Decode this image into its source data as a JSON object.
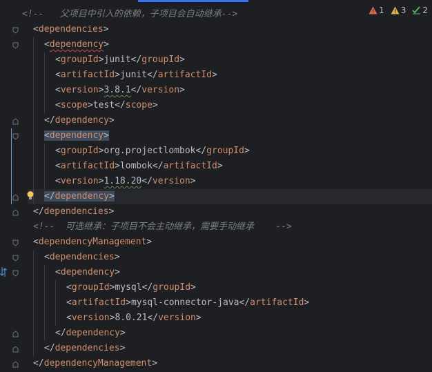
{
  "editor": {
    "inspections": {
      "errors": "1",
      "warnings": "3",
      "ok": "2"
    },
    "colors": {
      "background": "#1e1f22",
      "tag_name": "#d5b778",
      "bracket": "#bcbec4",
      "comment": "#7a7e85",
      "selection": "#3d4b5c",
      "accent": "#3574f0"
    },
    "lines": [
      {
        "comment": "<!--   父项目中引入的依赖，子项目会自动继承-->"
      },
      {
        "open": "dependencies"
      },
      {
        "open": "dependency"
      },
      {
        "tag": "groupId",
        "value": "junit"
      },
      {
        "tag": "artifactId",
        "value": "junit"
      },
      {
        "tag": "version",
        "value": "3.8.1"
      },
      {
        "tag": "scope",
        "value": "test"
      },
      {
        "close": "dependency"
      },
      {
        "open": "dependency"
      },
      {
        "tag": "groupId",
        "value": "org.projectlombok"
      },
      {
        "tag": "artifactId",
        "value": "lombok"
      },
      {
        "tag": "version",
        "value": "1.18.20"
      },
      {
        "close": "dependency"
      },
      {
        "close": "dependencies"
      },
      {
        "comment": "<!--  可选继承：子项目不会主动继承，需要手动继承    -->"
      },
      {
        "open": "dependencyManagement"
      },
      {
        "open": "dependencies"
      },
      {
        "open": "dependency"
      },
      {
        "tag": "groupId",
        "value": "mysql"
      },
      {
        "tag": "artifactId",
        "value": "mysql-connector-java"
      },
      {
        "tag": "version",
        "value": "8.0.21"
      },
      {
        "close": "dependency"
      },
      {
        "close": "dependencies"
      },
      {
        "close": "dependencyManagement"
      }
    ]
  }
}
